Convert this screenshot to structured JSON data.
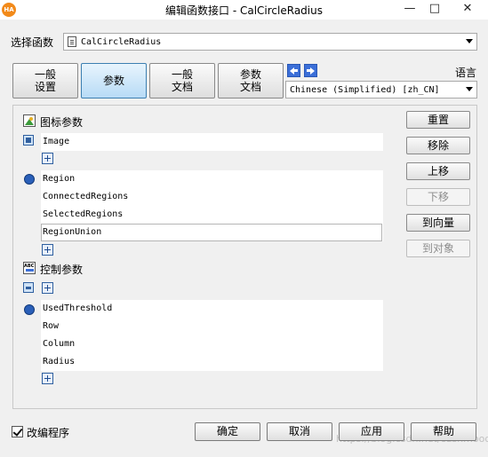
{
  "window": {
    "app_icon_text": "HA",
    "title": "编辑函数接口 - CalCircleRadius",
    "controls": {
      "minimize": "—",
      "maximize": "□",
      "close": "✕"
    }
  },
  "function_selector": {
    "label": "选择函数",
    "value": "CalCircleRadius"
  },
  "tabs": [
    {
      "label": "一般\n设置",
      "active": false
    },
    {
      "label": "参数",
      "active": true
    },
    {
      "label": "一般\n文档",
      "active": false
    },
    {
      "label": "参数\n文档",
      "active": false
    }
  ],
  "language": {
    "label": "语言",
    "value": "Chinese (Simplified) [zh_CN]"
  },
  "iconic_params": {
    "title": "图标参数",
    "input_items": [
      "Image"
    ],
    "output_items": [
      "Region",
      "ConnectedRegions",
      "SelectedRegions",
      "RegionUnion"
    ],
    "selected_item": "RegionUnion"
  },
  "control_params": {
    "title": "控制参数",
    "input_items": [],
    "output_items": [
      "UsedThreshold",
      "Row",
      "Column",
      "Radius"
    ]
  },
  "side_buttons": [
    {
      "label": "重置",
      "enabled": true
    },
    {
      "label": "移除",
      "enabled": true
    },
    {
      "label": "上移",
      "enabled": true
    },
    {
      "label": "下移",
      "enabled": false
    },
    {
      "label": "到向量",
      "enabled": true
    },
    {
      "label": "到对象",
      "enabled": false
    }
  ],
  "footer": {
    "checkbox_label": "改编程序",
    "checkbox_checked": true,
    "ok": "确定",
    "cancel": "取消",
    "apply": "应用",
    "help": "帮助",
    "watermark": "https://blog.csdn.net/cashmood"
  }
}
